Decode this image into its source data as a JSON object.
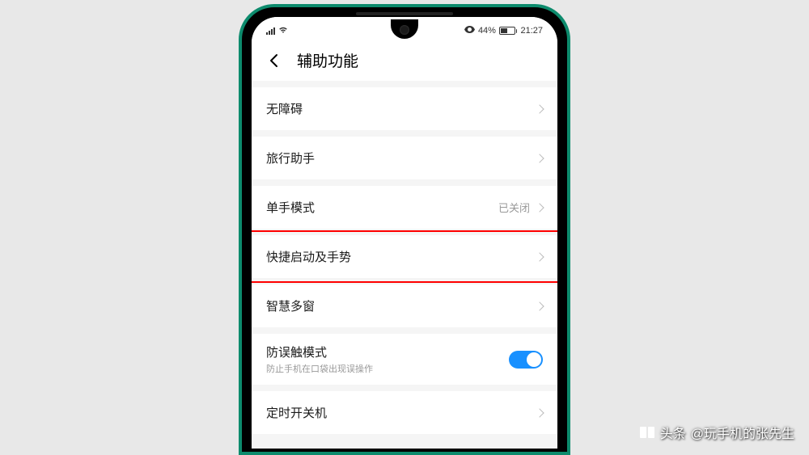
{
  "status": {
    "battery_percent": "44%",
    "time": "21:27"
  },
  "header": {
    "title": "辅助功能"
  },
  "items": [
    {
      "label": "无障碍",
      "type": "nav"
    },
    {
      "label": "旅行助手",
      "type": "nav"
    },
    {
      "label": "单手模式",
      "type": "nav",
      "value": "已关闭"
    },
    {
      "label": "快捷启动及手势",
      "type": "nav",
      "highlighted": true
    },
    {
      "label": "智慧多窗",
      "type": "nav"
    },
    {
      "label": "防误触模式",
      "sublabel": "防止手机在口袋出现误操作",
      "type": "toggle",
      "on": true
    },
    {
      "label": "定时开关机",
      "type": "nav"
    }
  ],
  "watermark": {
    "prefix": "头条",
    "text": "@玩手机的张先生"
  }
}
